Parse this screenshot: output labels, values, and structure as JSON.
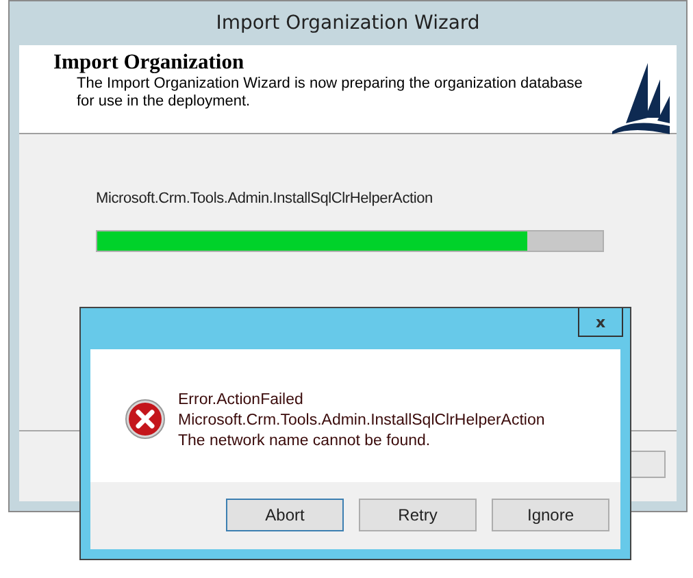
{
  "window": {
    "title": "Import Organization Wizard"
  },
  "header": {
    "title": "Import Organization",
    "description": "The Import Organization Wizard is now preparing the organization database for use in the deployment."
  },
  "progress": {
    "action": "Microsoft.Crm.Tools.Admin.InstallSqlClrHelperAction",
    "level": 0.85
  },
  "dialog": {
    "close": "x",
    "lines": [
      "Error.ActionFailed",
      "Microsoft.Crm.Tools.Admin.InstallSqlClrHelperAction",
      "The network name cannot be found."
    ],
    "buttons": [
      {
        "label": "Abort",
        "default": true
      },
      {
        "label": "Retry",
        "default": false
      },
      {
        "label": "Ignore",
        "default": false
      }
    ]
  }
}
